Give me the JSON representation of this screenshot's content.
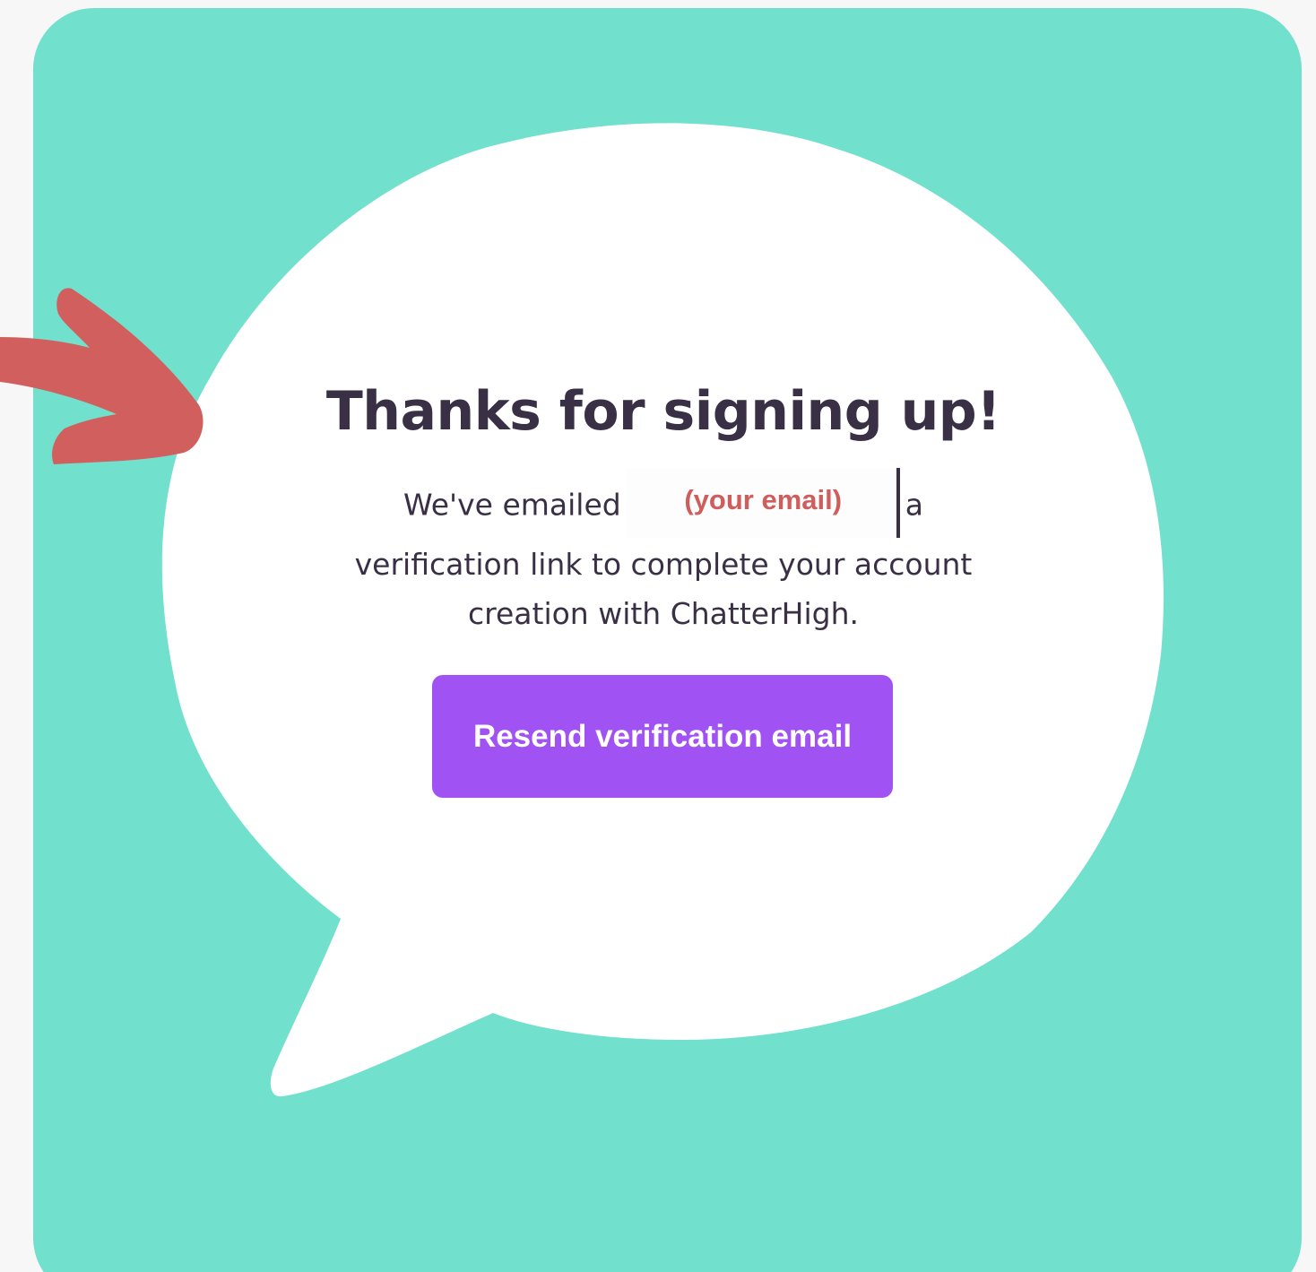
{
  "heading": "Thanks for signing up!",
  "message": {
    "before_email": "We've emailed",
    "email_placeholder": "(your email)",
    "after_email": "a",
    "line2": "verification link to complete your account",
    "line3": "creation with ChatterHigh."
  },
  "resend_button": {
    "label": "Resend verification email"
  },
  "colors": {
    "panel_background": "#71e0cc",
    "bubble": "#ffffff",
    "heading_text": "#3a3046",
    "button": "#a152f3",
    "arrow": "#d15f5d",
    "email_annotation": "#cf5d5b"
  }
}
